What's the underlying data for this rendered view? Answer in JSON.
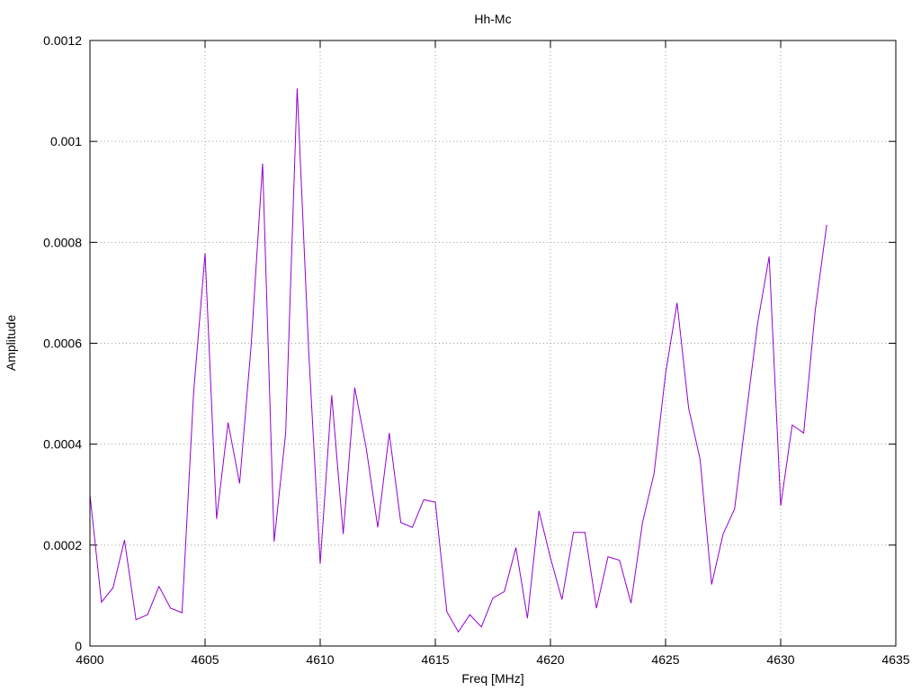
{
  "chart_data": {
    "type": "line",
    "title": "Hh-Mc",
    "xlabel": "Freq [MHz]",
    "ylabel": "Amplitude",
    "xlim": [
      4600,
      4635
    ],
    "ylim": [
      0,
      0.0012
    ],
    "x_ticks": [
      4600,
      4605,
      4610,
      4615,
      4620,
      4625,
      4630,
      4635
    ],
    "x_tick_labels": [
      "4600",
      "4605",
      "4610",
      "4615",
      "4620",
      "4625",
      "4630",
      "4635"
    ],
    "y_ticks": [
      0,
      0.0002,
      0.0004,
      0.0006,
      0.0008,
      0.001,
      0.0012
    ],
    "y_tick_labels": [
      "0",
      "0.0002",
      "0.0004",
      "0.0006",
      "0.0008",
      "0.001",
      "0.0012"
    ],
    "grid": true,
    "legend": "none",
    "line_color": "#9400d3",
    "series": [
      {
        "x": [
          4600,
          4600.5,
          4601,
          4601.5,
          4602,
          4602.5,
          4603,
          4603.5,
          4604,
          4604.5,
          4605,
          4605.5,
          4606,
          4606.5,
          4607,
          4607.5,
          4608,
          4608.5,
          4609,
          4609.5,
          4610,
          4610.5,
          4611,
          4611.5,
          4612,
          4612.5,
          4613,
          4613.5,
          4614,
          4614.5,
          4615,
          4615.5,
          4616,
          4616.5,
          4617,
          4617.5,
          4618,
          4618.5,
          4619,
          4619.5,
          4620,
          4620.5,
          4621,
          4621.5,
          4622,
          4622.5,
          4623,
          4623.5,
          4624,
          4624.5,
          4625,
          4625.5,
          4626,
          4626.5,
          4627,
          4627.5,
          4628,
          4628.5,
          4629,
          4629.5,
          4630,
          4630.5,
          4631,
          4631.5,
          4632
        ],
        "y": [
          0.0003,
          8.7e-05,
          0.000115,
          0.00021,
          5.2e-05,
          6.2e-05,
          0.000118,
          7.5e-05,
          6.6e-05,
          0.0005,
          0.000778,
          0.000252,
          0.000443,
          0.000322,
          0.000595,
          0.000956,
          0.000207,
          0.000422,
          0.001105,
          0.000585,
          0.000163,
          0.000497,
          0.000222,
          0.000512,
          0.000392,
          0.000235,
          0.000422,
          0.000245,
          0.000235,
          0.00029,
          0.000285,
          6.8e-05,
          2.8e-05,
          6.2e-05,
          3.8e-05,
          9.5e-05,
          0.000108,
          0.000195,
          5.5e-05,
          0.000268,
          0.000175,
          9.2e-05,
          0.000225,
          0.000225,
          7.5e-05,
          0.000177,
          0.00017,
          8.5e-05,
          0.000245,
          0.000342,
          0.00054,
          0.00068,
          0.000472,
          0.00037,
          0.000122,
          0.000222,
          0.000272,
          0.000458,
          0.00064,
          0.000772,
          0.000278,
          0.000438,
          0.000422,
          0.000665,
          0.000835
        ]
      }
    ]
  }
}
